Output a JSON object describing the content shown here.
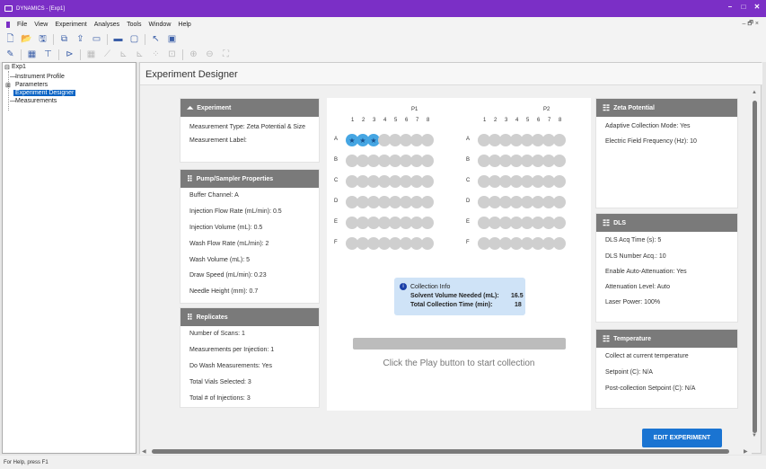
{
  "window": {
    "title": "DYNAMICS - [Exp1]",
    "min": "–",
    "max": "□",
    "close": "✕"
  },
  "menu": {
    "items": [
      "File",
      "View",
      "Experiment",
      "Analyses",
      "Tools",
      "Window",
      "Help"
    ],
    "mdi": "– 🗗 ×"
  },
  "tree": {
    "root": "Exp1",
    "items": [
      "Instrument Profile",
      "Parameters",
      "Experiment Designer",
      "Measurements"
    ],
    "expand_root": "⊟",
    "expand_params": "⊞"
  },
  "page_title": "Experiment Designer",
  "experiment": {
    "title": "Experiment",
    "type": "Measurement Type: Zeta Potential & Size",
    "label": "Measurement Label:"
  },
  "pump": {
    "title": "Pump/Sampler Properties",
    "rows": [
      "Buffer Channel: A",
      "Injection Flow Rate (mL/min): 0.5",
      "Injection Volume (mL): 0.5",
      "Wash Flow Rate (mL/min): 2",
      "Wash Volume (mL): 5",
      "Draw Speed (mL/min): 0.23",
      "Needle Height (mm): 0.7"
    ]
  },
  "replicates": {
    "title": "Replicates",
    "rows": [
      "Number of Scans: 1",
      "Measurements per Injection: 1",
      "Do Wash Measurements: Yes",
      "Total Vials Selected: 3",
      "Total # of Injections: 3"
    ]
  },
  "plates": [
    {
      "name": "P1",
      "columns": [
        "1",
        "2",
        "3",
        "4",
        "5",
        "6",
        "7",
        "8"
      ],
      "rows": [
        "A",
        "B",
        "C",
        "D",
        "E",
        "F"
      ],
      "selected": [
        [
          0,
          0
        ],
        [
          0,
          1
        ],
        [
          0,
          2
        ]
      ]
    },
    {
      "name": "P2",
      "columns": [
        "1",
        "2",
        "3",
        "4",
        "5",
        "6",
        "7",
        "8"
      ],
      "rows": [
        "A",
        "B",
        "C",
        "D",
        "E",
        "F"
      ],
      "selected": []
    }
  ],
  "collection": {
    "title": "Collection Info",
    "r1_label": "Solvent Volume Needed (mL):",
    "r1_val": "16.5",
    "r2_label": "Total Collection Time (min):",
    "r2_val": "18"
  },
  "play_message": "Click the Play button to start collection",
  "zeta": {
    "title": "Zeta Potential",
    "rows": [
      "Adaptive Collection Mode: Yes",
      "Electric Field Frequency (Hz): 10"
    ]
  },
  "dls": {
    "title": "DLS",
    "rows": [
      "DLS Acq Time (s): 5",
      "DLS Number Acq.: 10",
      "Enable Auto-Attenuation: Yes",
      "Attenuation Level: Auto",
      "Laser Power: 100%"
    ]
  },
  "temperature": {
    "title": "Temperature",
    "rows": [
      "Collect at current temperature",
      "Setpoint (C): N/A",
      "Post-collection Setpoint (C): N/A"
    ]
  },
  "edit_button": "EDIT EXPERIMENT",
  "status_text": "For Help, press F1",
  "colors": {
    "titlebar": "#7b2fc6",
    "header": "#7a7a7a",
    "accent": "#1a74d2",
    "well_on": "#46a6e3",
    "well_off": "#cfcfcf"
  }
}
